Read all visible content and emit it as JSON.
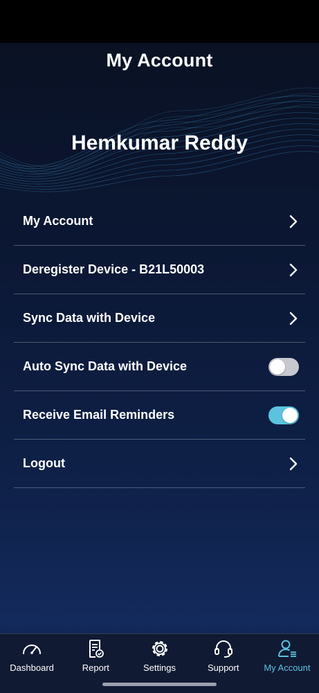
{
  "header": {
    "title": "My Account"
  },
  "profile": {
    "name": "Hemkumar Reddy"
  },
  "menu": {
    "items": [
      {
        "label": "My Account",
        "type": "chevron"
      },
      {
        "label": "Deregister Device - B21L50003",
        "type": "chevron"
      },
      {
        "label": "Sync Data with Device",
        "type": "chevron"
      },
      {
        "label": "Auto Sync Data with Device",
        "type": "toggle",
        "enabled": false
      },
      {
        "label": "Receive Email Reminders",
        "type": "toggle",
        "enabled": true
      },
      {
        "label": "Logout",
        "type": "chevron"
      }
    ]
  },
  "tabs": [
    {
      "label": "Dashboard",
      "icon": "speedometer-icon"
    },
    {
      "label": "Report",
      "icon": "report-icon"
    },
    {
      "label": "Settings",
      "icon": "gear-icon"
    },
    {
      "label": "Support",
      "icon": "headset-icon"
    },
    {
      "label": "My Account",
      "icon": "account-icon",
      "active": true
    }
  ],
  "colors": {
    "accent": "#5cc3df",
    "toggle_off": "#c7c9cf"
  }
}
